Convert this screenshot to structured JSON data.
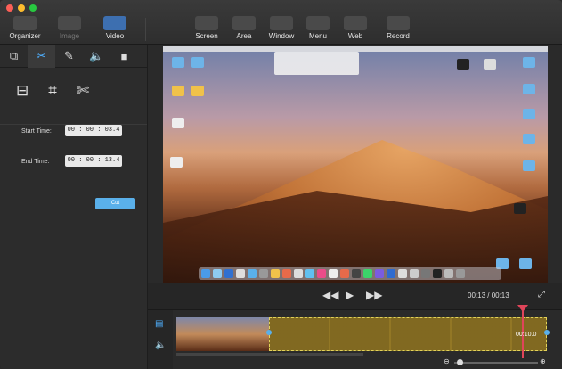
{
  "toolbar": {
    "items": [
      {
        "label": "Organizer",
        "icon": "grid-icon"
      },
      {
        "label": "Image",
        "icon": "image-icon"
      },
      {
        "label": "Video",
        "icon": "video-icon"
      },
      {
        "label": "Screen",
        "icon": "screen-icon"
      },
      {
        "label": "Area",
        "icon": "area-icon"
      },
      {
        "label": "Window",
        "icon": "window-icon"
      },
      {
        "label": "Menu",
        "icon": "menu-icon"
      },
      {
        "label": "Web",
        "icon": "web-icon"
      },
      {
        "label": "Record",
        "icon": "record-icon"
      }
    ]
  },
  "left_panel": {
    "start_time_label": "Start Time:",
    "start_time_value": "00 : 00 : 03.4",
    "end_time_label": "End Time:",
    "end_time_value": "00 : 00 : 13.4",
    "cut_label": "Cut"
  },
  "player": {
    "timecode": "00:13 / 00:13"
  },
  "timeline": {
    "playhead_time": "00:10.0"
  },
  "colors": {
    "accent": "#5ab0ea",
    "selection": "#d2b41e",
    "playhead": "#e0455a"
  }
}
